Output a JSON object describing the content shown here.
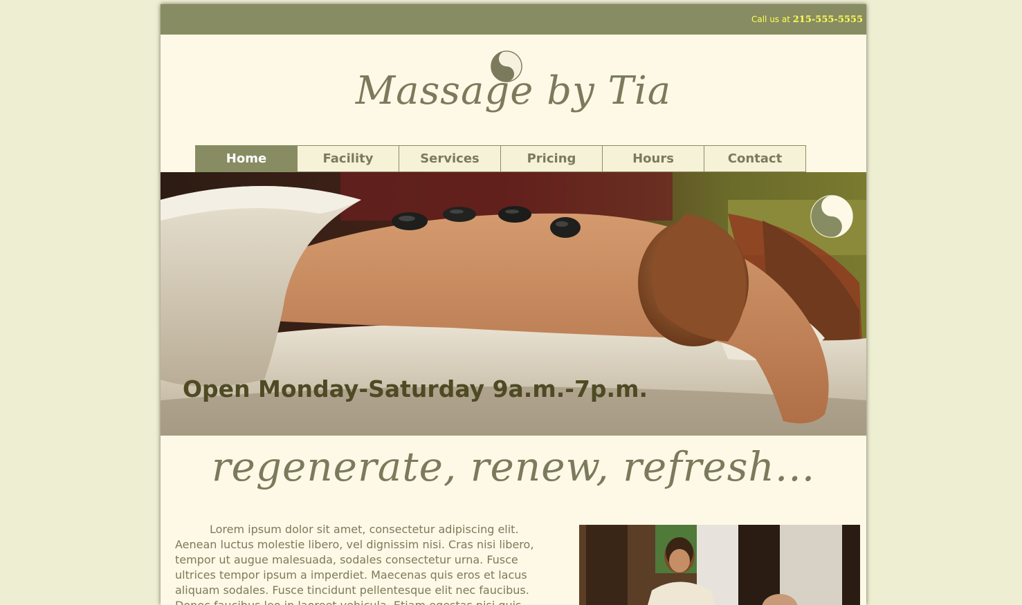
{
  "header": {
    "call_prefix": "Call us at ",
    "phone": "215-555-5555"
  },
  "brand": {
    "title": "Massage by Tia",
    "logo_icon": "yin-yang-icon"
  },
  "nav": {
    "items": [
      {
        "label": "Home",
        "active": true
      },
      {
        "label": "Facility",
        "active": false
      },
      {
        "label": "Services",
        "active": false
      },
      {
        "label": "Pricing",
        "active": false
      },
      {
        "label": "Hours",
        "active": false
      },
      {
        "label": "Contact",
        "active": false
      }
    ]
  },
  "hero": {
    "caption": "Open Monday-Saturday 9a.m.-7p.m.",
    "image": "hot-stone-massage-photo",
    "badge_icon": "yin-yang-icon"
  },
  "tagline": "regenerate, renew, refresh...",
  "content": {
    "paragraph": "Lorem ipsum dolor sit amet, consectetur adipiscing elit. Aenean luctus molestie libero, vel dignissim nisi. Cras nisi libero, tempor ut augue malesuada, sodales consectetur urna. Fusce ultrices tempor ipsum a imperdiet. Maecenas quis eros et lacus aliquam sodales. Fusce tincidunt pellentesque elit nec faucibus. Donec faucibus leo in laoreet vehicula. Etiam egestas nisi quis elit",
    "side_image": "thai-massage-photo"
  },
  "colors": {
    "page_bg": "#eeeed2",
    "content_bg": "#fdf9e6",
    "olive": "#888c62",
    "text": "#7b7a5c",
    "phone_yellow": "#ffff55",
    "caption": "#4e4a24"
  }
}
